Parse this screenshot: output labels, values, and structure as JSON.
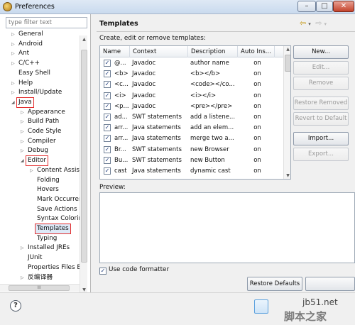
{
  "window": {
    "title": "Preferences",
    "min": "–",
    "max": "□",
    "close": "✕"
  },
  "sidebar": {
    "filter_placeholder": "type filter text",
    "items": [
      {
        "label": "General",
        "arrow": "▷",
        "indent": 0
      },
      {
        "label": "Android",
        "arrow": "▷",
        "indent": 0
      },
      {
        "label": "Ant",
        "arrow": "▷",
        "indent": 0
      },
      {
        "label": "C/C++",
        "arrow": "▷",
        "indent": 0
      },
      {
        "label": "Easy Shell",
        "arrow": "",
        "indent": 0
      },
      {
        "label": "Help",
        "arrow": "▷",
        "indent": 0
      },
      {
        "label": "Install/Update",
        "arrow": "▷",
        "indent": 0
      },
      {
        "label": "Java",
        "arrow": "◢",
        "indent": 0
      },
      {
        "label": "Appearance",
        "arrow": "▷",
        "indent": 1
      },
      {
        "label": "Build Path",
        "arrow": "▷",
        "indent": 1
      },
      {
        "label": "Code Style",
        "arrow": "▷",
        "indent": 1
      },
      {
        "label": "Compiler",
        "arrow": "▷",
        "indent": 1
      },
      {
        "label": "Debug",
        "arrow": "▷",
        "indent": 1
      },
      {
        "label": "Editor",
        "arrow": "◢",
        "indent": 1
      },
      {
        "label": "Content Assist",
        "arrow": "▷",
        "indent": 2
      },
      {
        "label": "Folding",
        "arrow": "",
        "indent": 2
      },
      {
        "label": "Hovers",
        "arrow": "",
        "indent": 2
      },
      {
        "label": "Mark Occurren",
        "arrow": "",
        "indent": 2
      },
      {
        "label": "Save Actions",
        "arrow": "",
        "indent": 2
      },
      {
        "label": "Syntax Coloring",
        "arrow": "",
        "indent": 2
      },
      {
        "label": "Templates",
        "arrow": "",
        "indent": 2
      },
      {
        "label": "Typing",
        "arrow": "",
        "indent": 2
      },
      {
        "label": "Installed JREs",
        "arrow": "▷",
        "indent": 1
      },
      {
        "label": "JUnit",
        "arrow": "",
        "indent": 1
      },
      {
        "label": "Properties Files Ed",
        "arrow": "",
        "indent": 1
      },
      {
        "label": "反编译器",
        "arrow": "▷",
        "indent": 1
      }
    ],
    "hscroll_grip": "III"
  },
  "main": {
    "title": "Templates",
    "description": "Create, edit or remove templates:",
    "nav": {
      "back": "⇦",
      "back_menu": "▾",
      "forward": "⇨",
      "forward_menu": "▾"
    },
    "columns": [
      "Name",
      "Context",
      "Description",
      "Auto Ins..."
    ],
    "rows": [
      {
        "name": "@...",
        "context": "Javadoc",
        "description": "author name",
        "auto": "on"
      },
      {
        "name": "<b>",
        "context": "Javadoc",
        "description": "<b></b>",
        "auto": "on"
      },
      {
        "name": "<c...",
        "context": "Javadoc",
        "description": "<code></co...",
        "auto": "on"
      },
      {
        "name": "<i>",
        "context": "Javadoc",
        "description": "<i></i>",
        "auto": "on"
      },
      {
        "name": "<p...",
        "context": "Javadoc",
        "description": "<pre></pre>",
        "auto": "on"
      },
      {
        "name": "ad...",
        "context": "SWT statements",
        "description": "add a listene...",
        "auto": "on"
      },
      {
        "name": "arr...",
        "context": "Java statements",
        "description": "add an elem...",
        "auto": "on"
      },
      {
        "name": "arr...",
        "context": "Java statements",
        "description": "merge two a...",
        "auto": "on"
      },
      {
        "name": "Br...",
        "context": "SWT statements",
        "description": "new Browser",
        "auto": "on"
      },
      {
        "name": "Bu...",
        "context": "SWT statements",
        "description": "new Button",
        "auto": "on"
      },
      {
        "name": "cast",
        "context": "Java statements",
        "description": "dynamic cast",
        "auto": "on"
      }
    ],
    "checkmark": "✓",
    "buttons": {
      "new": "New...",
      "edit": "Edit...",
      "remove": "Remove",
      "restore_removed": "Restore Removed",
      "revert_default": "Revert to Default",
      "import": "Import...",
      "export": "Export..."
    },
    "preview_label": "Preview:",
    "use_formatter": "Use code formatter",
    "restore_defaults": "Restore Defaults"
  },
  "footer": {
    "help": "?",
    "watermark_url": "jb51.net",
    "watermark_text": "脚本之家"
  }
}
